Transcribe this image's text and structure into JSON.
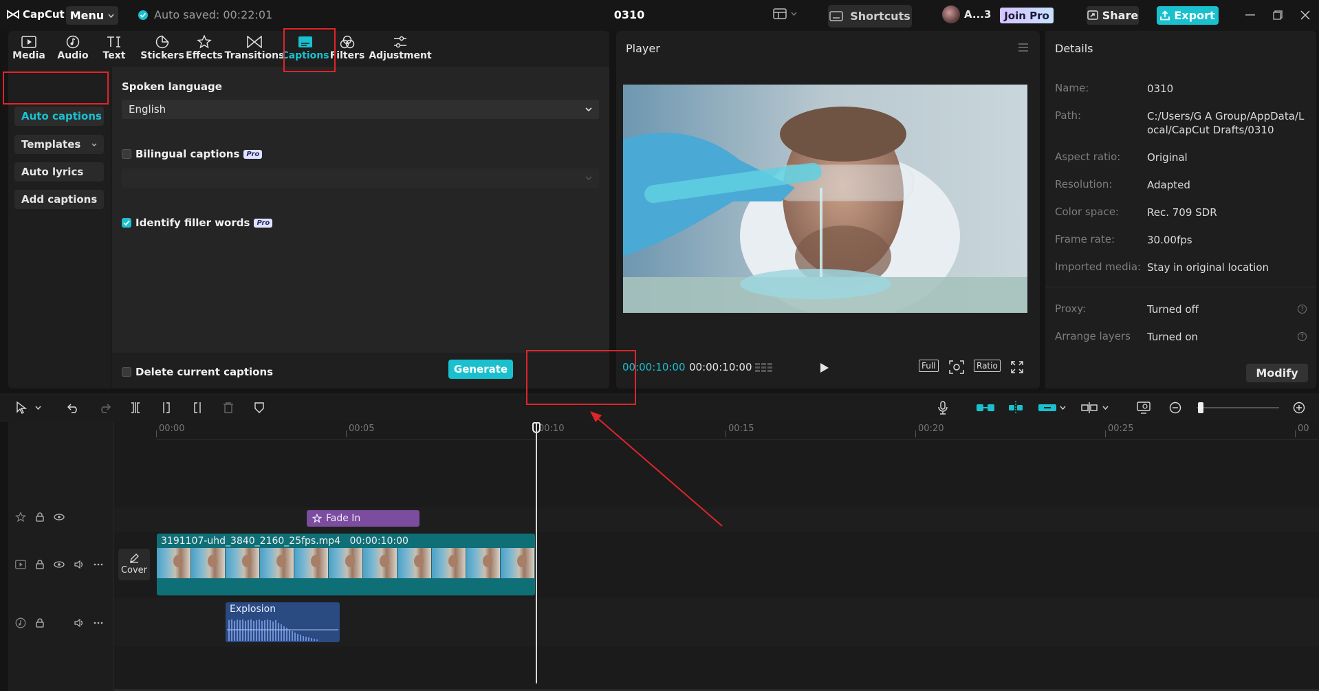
{
  "app": {
    "logo_text": "CapCut",
    "menu_label": "Menu",
    "autosave": "Auto saved: 00:22:01",
    "project_title": "0310",
    "shortcuts_label": "Shortcuts",
    "user_label": "A...3",
    "join_pro_label": "Join Pro",
    "share_label": "Share",
    "export_label": "Export"
  },
  "tabs": [
    {
      "label": "Media",
      "icon": "media-icon"
    },
    {
      "label": "Audio",
      "icon": "audio-icon"
    },
    {
      "label": "Text",
      "icon": "text-icon"
    },
    {
      "label": "Stickers",
      "icon": "stickers-icon"
    },
    {
      "label": "Effects",
      "icon": "effects-icon"
    },
    {
      "label": "Transitions",
      "icon": "transitions-icon"
    },
    {
      "label": "Captions",
      "icon": "captions-icon",
      "active": true
    },
    {
      "label": "Filters",
      "icon": "filters-icon"
    },
    {
      "label": "Adjustment",
      "icon": "adjustment-icon"
    }
  ],
  "subnav": [
    {
      "label": "Auto captions",
      "active": true
    },
    {
      "label": "Templates"
    },
    {
      "label": "Auto lyrics"
    },
    {
      "label": "Add captions"
    }
  ],
  "captions": {
    "spoken_language_label": "Spoken language",
    "spoken_language_value": "English",
    "bilingual_label": "Bilingual captions",
    "bilingual_checked": false,
    "pro_badge": "Pro",
    "filler_label": "Identify filler words",
    "filler_checked": true,
    "delete_label": "Delete current captions",
    "delete_checked": false,
    "generate_label": "Generate"
  },
  "player": {
    "title": "Player",
    "current_time": "00:00:10:00",
    "total_time": "00:00:10:00",
    "full_label": "Full",
    "ratio_label": "Ratio"
  },
  "details": {
    "title": "Details",
    "rows": [
      {
        "key": "Name:",
        "value": "0310"
      },
      {
        "key": "Path:",
        "value": "C:/Users/G A Group/AppData/Local/CapCut Drafts/0310"
      },
      {
        "key": "Aspect ratio:",
        "value": "Original"
      },
      {
        "key": "Resolution:",
        "value": "Adapted"
      },
      {
        "key": "Color space:",
        "value": "Rec. 709 SDR"
      },
      {
        "key": "Frame rate:",
        "value": "30.00fps"
      },
      {
        "key": "Imported media:",
        "value": "Stay in original location"
      },
      {
        "key": "Proxy:",
        "value": "Turned off"
      },
      {
        "key": "Arrange layers",
        "value": "Turned on"
      }
    ],
    "modify_label": "Modify"
  },
  "timeline": {
    "ruler": [
      "00:00",
      "00:05",
      "00:10",
      "00:15",
      "00:20",
      "00:25",
      "00"
    ],
    "cover_label": "Cover",
    "effect_clip": "Fade In",
    "video_clip_name": "3191107-uhd_3840_2160_25fps.mp4",
    "video_clip_duration": "00:00:10:00",
    "audio_clip_name": "Explosion"
  },
  "colors": {
    "accent": "#19c1cf",
    "annotation": "#e0242b",
    "effect_clip": "#7c4d9e",
    "video_clip": "#0f6f76",
    "audio_clip": "#2a4a82"
  }
}
